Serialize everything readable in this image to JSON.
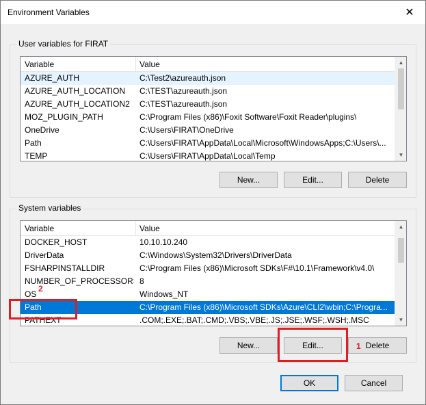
{
  "window": {
    "title": "Environment Variables",
    "close_glyph": "✕"
  },
  "user_vars": {
    "group_label": "User variables for FIRAT",
    "columns": [
      "Variable",
      "Value"
    ],
    "rows": [
      {
        "variable": "AZURE_AUTH",
        "value": "C:\\Test2\\azureauth.json"
      },
      {
        "variable": "AZURE_AUTH_LOCATION",
        "value": "C:\\TEST\\azureauth.json"
      },
      {
        "variable": "AZURE_AUTH_LOCATION2",
        "value": "C:\\TEST\\azureauth.json"
      },
      {
        "variable": "MOZ_PLUGIN_PATH",
        "value": "C:\\Program Files (x86)\\Foxit Software\\Foxit Reader\\plugins\\"
      },
      {
        "variable": "OneDrive",
        "value": "C:\\Users\\FIRAT\\OneDrive"
      },
      {
        "variable": "Path",
        "value": "C:\\Users\\FIRAT\\AppData\\Local\\Microsoft\\WindowsApps;C:\\Users\\..."
      },
      {
        "variable": "TEMP",
        "value": "C:\\Users\\FIRAT\\AppData\\Local\\Temp"
      }
    ],
    "buttons": {
      "new": "New...",
      "edit": "Edit...",
      "delete": "Delete"
    }
  },
  "system_vars": {
    "group_label": "System variables",
    "columns": [
      "Variable",
      "Value"
    ],
    "rows": [
      {
        "variable": "DOCKER_HOST",
        "value": "10.10.10.240"
      },
      {
        "variable": "DriverData",
        "value": "C:\\Windows\\System32\\Drivers\\DriverData"
      },
      {
        "variable": "FSHARPINSTALLDIR",
        "value": "C:\\Program Files (x86)\\Microsoft SDKs\\F#\\10.1\\Framework\\v4.0\\"
      },
      {
        "variable": "NUMBER_OF_PROCESSORS",
        "value": "8"
      },
      {
        "variable": "OS",
        "value": "Windows_NT"
      },
      {
        "variable": "Path",
        "value": "C:\\Program Files (x86)\\Microsoft SDKs\\Azure\\CLI2\\wbin;C:\\Progra..."
      },
      {
        "variable": "PATHEXT",
        "value": ".COM;.EXE;.BAT;.CMD;.VBS;.VBE;.JS;.JSE;.WSF;.WSH;.MSC"
      }
    ],
    "selected_row": "Path",
    "buttons": {
      "new": "New...",
      "edit": "Edit...",
      "delete": "Delete"
    }
  },
  "footer": {
    "ok": "OK",
    "cancel": "Cancel"
  },
  "annotations": {
    "one": "1",
    "two": "2"
  },
  "icons": {
    "close": "close-icon",
    "scroll_up": "chevron-up-icon",
    "scroll_down": "chevron-down-icon"
  },
  "colors": {
    "selection": "#0078d7",
    "annotation": "#e01c24"
  }
}
